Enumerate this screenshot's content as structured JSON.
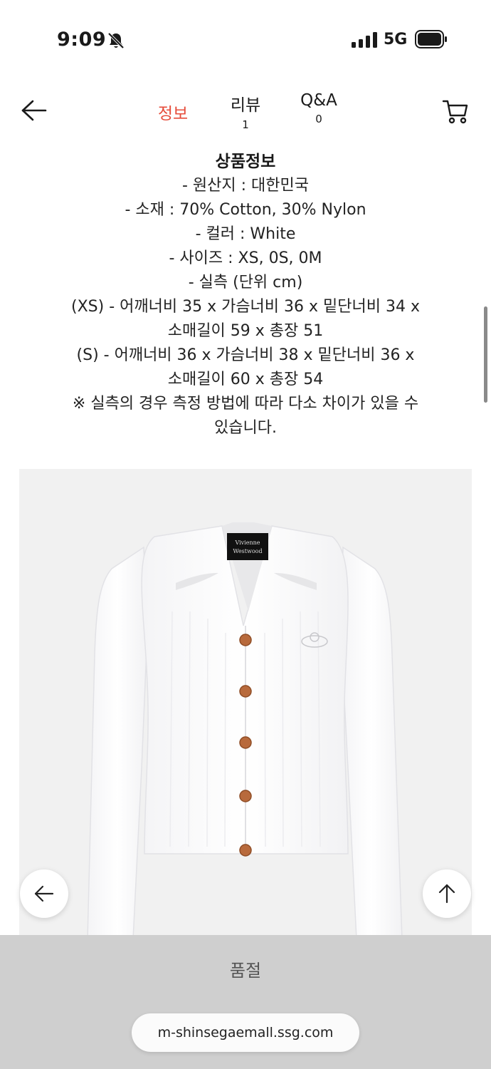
{
  "status": {
    "time": "9:09",
    "network": "5G",
    "icons": [
      "bell-slash-icon",
      "signal-icon",
      "battery-icon"
    ]
  },
  "header": {
    "back_icon": "arrow-left-icon",
    "cart_icon": "cart-icon",
    "tabs": [
      {
        "label": "정보",
        "count": "",
        "active": true
      },
      {
        "label": "리뷰",
        "count": "1",
        "active": false
      },
      {
        "label": "Q&A",
        "count": "0",
        "active": false
      }
    ],
    "active_color": "#e64c3b"
  },
  "product_info": {
    "title": "상품정보",
    "lines": [
      "- 원산지 : 대한민국",
      "- 소재 : 70% Cotton, 30% Nylon",
      "- 컬러 : White",
      "- 사이즈 : XS, 0S, 0M",
      "- 실측 (단위 cm)",
      "(XS) - 어깨너비 35 x 가슴너비 36 x 밑단너비 34 x",
      "소매길이 59 x 총장 51",
      "(S) - 어깨너비 36 x 가슴너비 38 x 밑단너비 36 x",
      "소매길이 60 x 총장 54",
      "※ 실측의 경우 측정 방법에 따라 다소 차이가 있을 수",
      "있습니다."
    ]
  },
  "product_image": {
    "label_text_1": "Vivienne",
    "label_text_2": "Westwood"
  },
  "floating": {
    "prev_icon": "arrow-left-icon",
    "top_icon": "arrow-up-icon"
  },
  "bottom": {
    "soldout": "품절",
    "url": "m-shinsegaemall.ssg.com"
  }
}
